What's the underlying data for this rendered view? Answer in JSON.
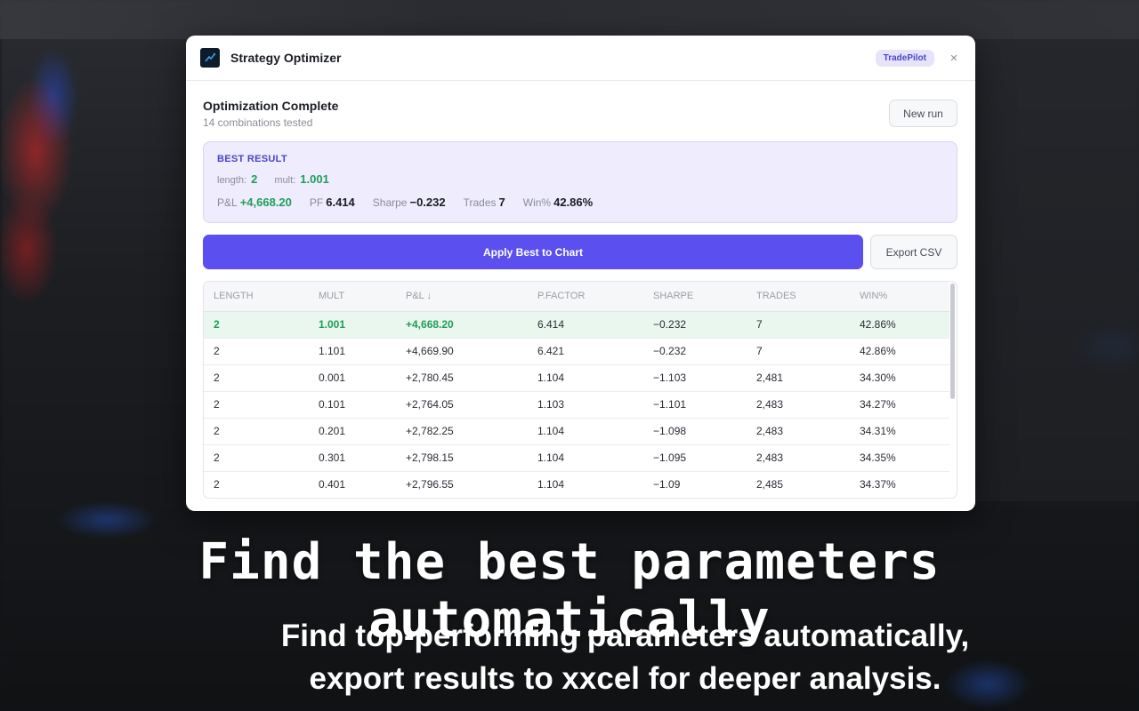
{
  "dialog": {
    "title": "Strategy Optimizer",
    "brand": "TradePilot",
    "close": "×"
  },
  "status": {
    "title": "Optimization Complete",
    "subtitle": "14 combinations tested",
    "new_run": "New run"
  },
  "best": {
    "label": "BEST RESULT",
    "length_label": "length:",
    "length_value": "2",
    "mult_label": "mult:",
    "mult_value": "1.001",
    "pnl_label": "P&L",
    "pnl_value": "+4,668.20",
    "pf_label": "PF",
    "pf_value": "6.414",
    "sharpe_label": "Sharpe",
    "sharpe_value": "−0.232",
    "trades_label": "Trades",
    "trades_value": "7",
    "win_label": "Win%",
    "win_value": "42.86%"
  },
  "actions": {
    "apply": "Apply Best to Chart",
    "export": "Export CSV"
  },
  "table": {
    "headers": [
      "LENGTH",
      "MULT",
      "P&L ↓",
      "P.FACTOR",
      "SHARPE",
      "TRADES",
      "WIN%"
    ],
    "rows": [
      [
        "2",
        "1.001",
        "+4,668.20",
        "6.414",
        "−0.232",
        "7",
        "42.86%"
      ],
      [
        "2",
        "1.101",
        "+4,669.90",
        "6.421",
        "−0.232",
        "7",
        "42.86%"
      ],
      [
        "2",
        "0.001",
        "+2,780.45",
        "1.104",
        "−1.103",
        "2,481",
        "34.30%"
      ],
      [
        "2",
        "0.101",
        "+2,764.05",
        "1.103",
        "−1.101",
        "2,483",
        "34.27%"
      ],
      [
        "2",
        "0.201",
        "+2,782.25",
        "1.104",
        "−1.098",
        "2,483",
        "34.31%"
      ],
      [
        "2",
        "0.301",
        "+2,798.15",
        "1.104",
        "−1.095",
        "2,483",
        "34.35%"
      ],
      [
        "2",
        "0.401",
        "+2,796.55",
        "1.104",
        "−1.09",
        "2,485",
        "34.37%"
      ]
    ]
  },
  "caption": {
    "headline": "Find the best parameters automatically",
    "line1": "Find top-performing parameters  automatically,",
    "line2": "export results to xxcel for deeper analysis."
  },
  "colors": {
    "accent": "#5b4ff0",
    "positive": "#1e9e5a",
    "best_card_bg": "#eeecfd"
  },
  "icons": {
    "logo": "app-logo-icon",
    "close": "close-icon"
  }
}
